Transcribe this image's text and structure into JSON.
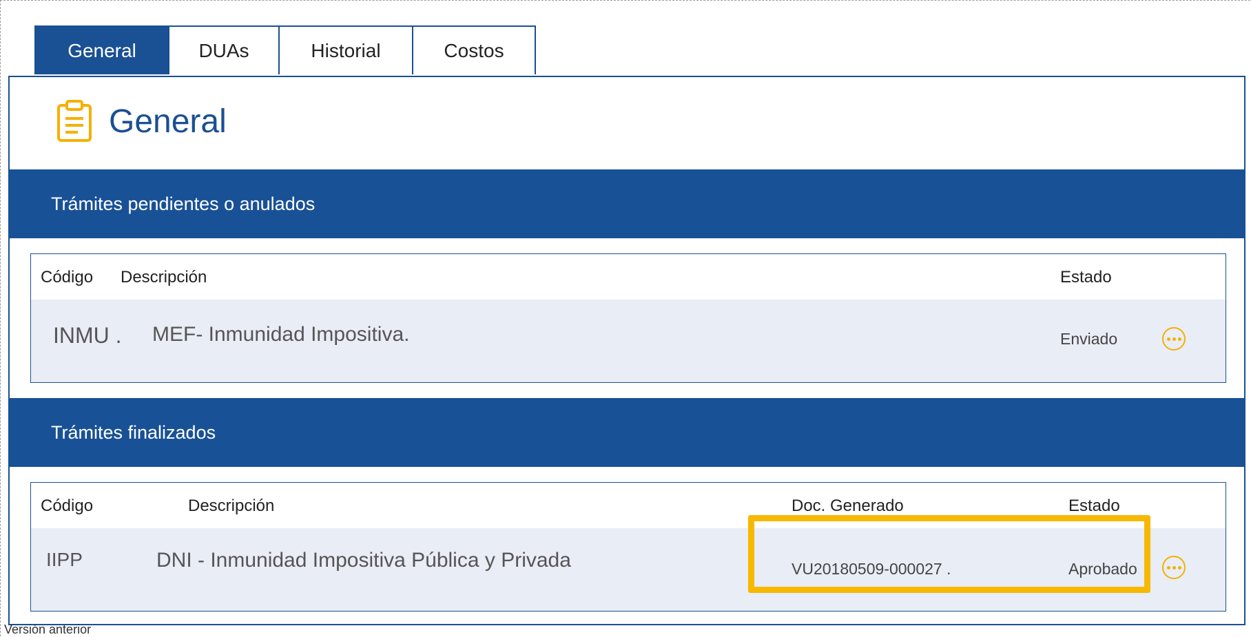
{
  "tabs": [
    {
      "label": "General",
      "active": true
    },
    {
      "label": "DUAs",
      "active": false
    },
    {
      "label": "Historial",
      "active": false
    },
    {
      "label": "Costos",
      "active": false
    }
  ],
  "page": {
    "title": "General",
    "icon": "clipboard-icon"
  },
  "pending": {
    "section_title": "Trámites pendientes o anulados",
    "columns": {
      "code": "Código",
      "description": "Descripción",
      "status": "Estado"
    },
    "rows": [
      {
        "code": "INMU .",
        "description": "MEF- Inmunidad Impositiva.",
        "status": "Enviado",
        "action_icon": "more-options-icon"
      }
    ]
  },
  "finished": {
    "section_title": "Trámites finalizados",
    "columns": {
      "code": "Código",
      "description": "Descripción",
      "document": "Doc. Generado",
      "status": "Estado"
    },
    "rows": [
      {
        "code": "IIPP",
        "description": "DNI - Inmunidad Impositiva Pública y Privada",
        "document": "VU20180509-000027 .",
        "status": "Aprobado",
        "action_icon": "more-options-icon"
      }
    ]
  },
  "footer": {
    "version_link": "Versión anterior"
  },
  "colors": {
    "primary": "#1a5094",
    "accent": "#f5b000",
    "row_background": "#e8edf6"
  }
}
